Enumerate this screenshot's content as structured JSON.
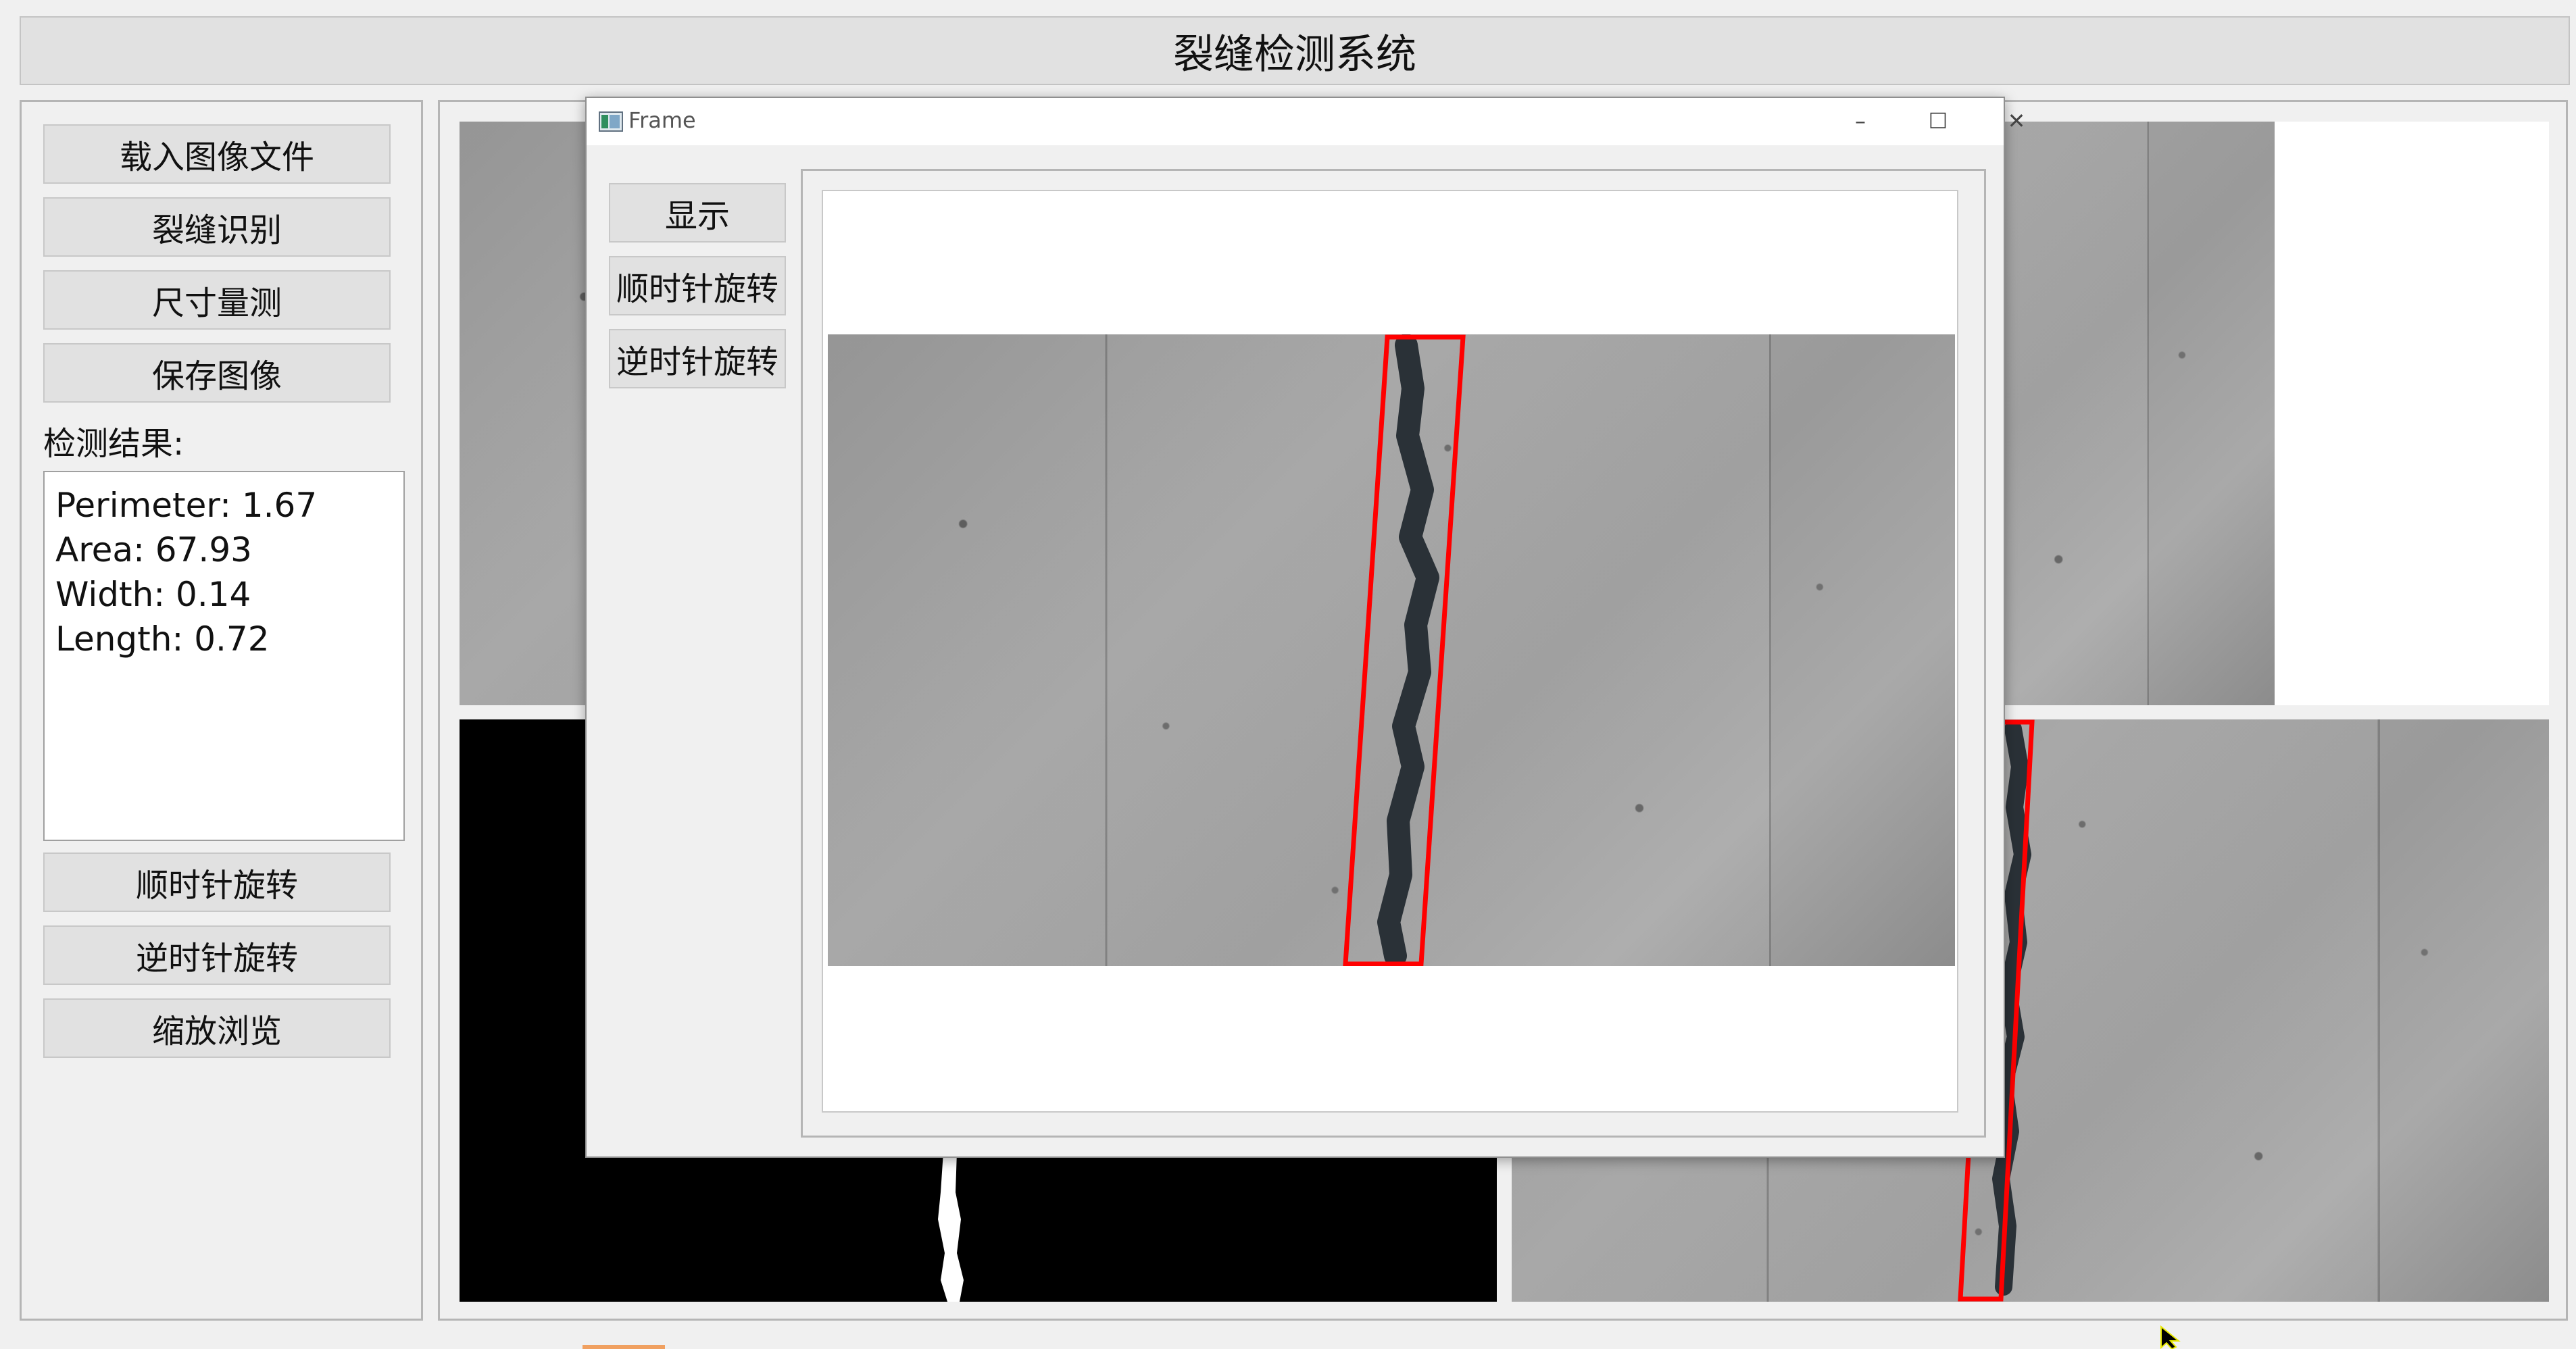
{
  "app": {
    "title": "裂缝检测系统"
  },
  "left_panel": {
    "buttons": {
      "load_image": "载入图像文件",
      "crack_recognition": "裂缝识别",
      "size_measure": "尺寸量测",
      "save_image": "保存图像",
      "rotate_clockwise": "顺时针旋转",
      "rotate_counterclockwise": "逆时针旋转",
      "zoom_browse": "缩放浏览"
    },
    "result_label": "检测结果:",
    "results": [
      "Perimeter: 1.67",
      "Area: 67.93",
      "Width: 0.14",
      "Length: 0.72"
    ]
  },
  "dialog": {
    "title": "Frame",
    "buttons": {
      "show": "显示",
      "rotate_clockwise": "顺时针旋转",
      "rotate_counterclockwise": "逆时针旋转"
    },
    "window_buttons": {
      "minimize": "–",
      "maximize": "☐",
      "close": "✕"
    }
  },
  "colors": {
    "box_outline": "#ff0000",
    "button_bg": "#e1e1e1",
    "window_bg": "#f0f0f0"
  }
}
